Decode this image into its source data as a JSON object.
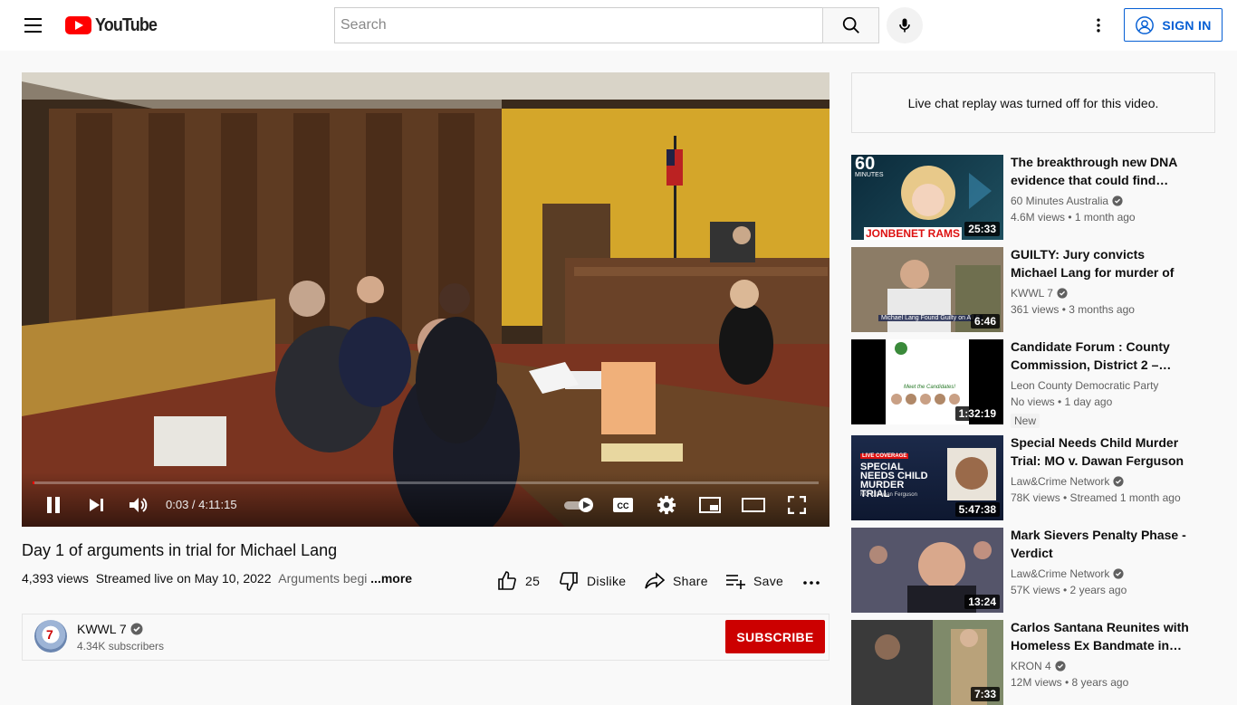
{
  "header": {
    "logo_text": "YouTube",
    "search_placeholder": "Search",
    "signin_label": "SIGN IN"
  },
  "player": {
    "time_display": "0:03 / 4:11:15",
    "progress_fraction": 0.0002
  },
  "video": {
    "title": "Day 1 of arguments in trial for Michael Lang",
    "views": "4,393 views",
    "streamed": "Streamed live on May 10, 2022",
    "description_preview": "Arguments begi",
    "more_label": "...more",
    "like_count": "25",
    "dislike_label": "Dislike",
    "share_label": "Share",
    "save_label": "Save"
  },
  "channel": {
    "avatar_text": "7",
    "name": "KWWL 7",
    "subscribers": "4.34K subscribers",
    "subscribe_label": "SUBSCRIBE"
  },
  "chat": {
    "message": "Live chat replay was turned off for this video."
  },
  "recommendations": [
    {
      "title": "The breakthrough new DNA evidence that could find…",
      "channel": "60 Minutes Australia",
      "verified": true,
      "stats": "4.6M views • 1 month ago",
      "duration": "25:33",
      "thumb_text_top": "60",
      "thumb_text_top_sub": "MINUTES",
      "thumb_caption": "JONBENET RAMS"
    },
    {
      "title": "GUILTY: Jury convicts Michael Lang for murder of Sgt. Jim…",
      "channel": "KWWL 7",
      "verified": true,
      "stats": "361 views • 3 months ago",
      "duration": "6:46",
      "thumb_caption": "Michael Lang Found Guilty on All C"
    },
    {
      "title": "Candidate Forum : County Commission, District 2 –…",
      "channel": "Leon County Democratic Party",
      "verified": false,
      "stats": "No views • 1 day ago",
      "badge": "New",
      "duration": "1:32:19",
      "thumb_caption": "Meet the Candidates!"
    },
    {
      "title": "Special Needs Child Murder Trial: MO v. Dawan Ferguson -…",
      "channel": "Law&Crime Network",
      "verified": true,
      "stats": "78K views • Streamed 1 month ago",
      "duration": "5:47:38",
      "thumb_tag": "LIVE COVERAGE",
      "thumb_caption": "SPECIAL NEEDS CHILD MURDER TRIAL",
      "thumb_sub": "MO v. Dawan Ferguson"
    },
    {
      "title": "Mark Sievers Penalty Phase - Verdict",
      "channel": "Law&Crime Network",
      "verified": true,
      "stats": "57K views • 2 years ago",
      "duration": "13:24"
    },
    {
      "title": "Carlos Santana Reunites with Homeless Ex Bandmate in…",
      "channel": "KRON 4",
      "verified": true,
      "stats": "12M views • 8 years ago",
      "duration": "7:33"
    }
  ]
}
